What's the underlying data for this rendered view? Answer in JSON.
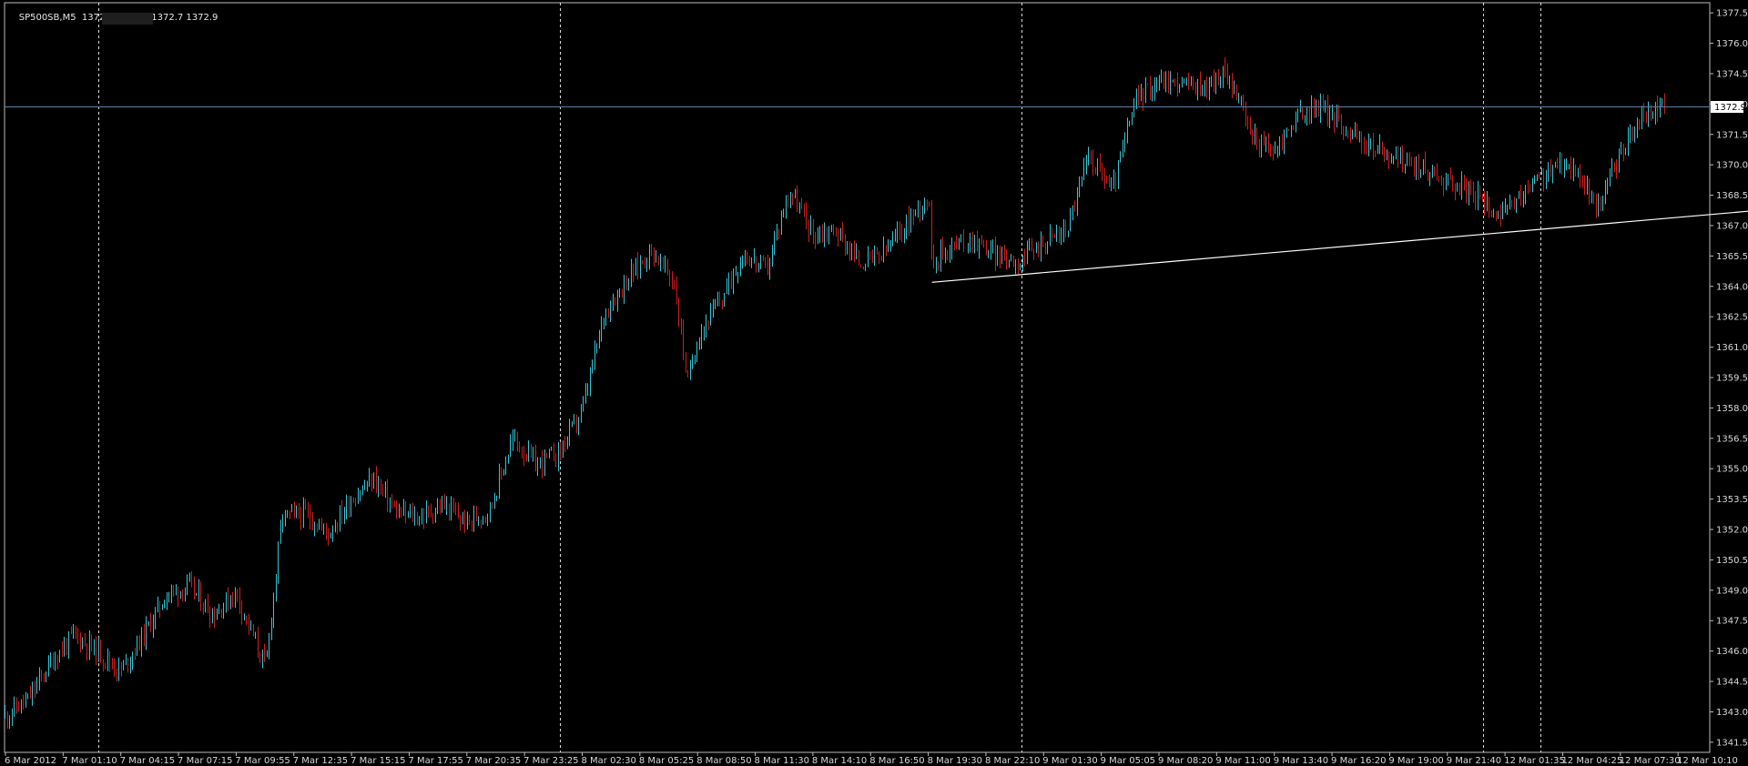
{
  "header": {
    "symbol": "SP500SB,M5",
    "ohlc": "1372.7 1372.9 1372.7 1372.9"
  },
  "colors": {
    "background": "#000000",
    "bull": "#33c6d6",
    "bear": "#d21c1c",
    "grid": "#ffffff",
    "price_line": "#5b7fa8",
    "trendline": "#ffffff",
    "axis_text": "#d8d8d8"
  },
  "chart_data": {
    "type": "line",
    "subtype": "candlestick",
    "title": "",
    "xlabel": "",
    "ylabel": "",
    "ylim": [
      1341.0,
      1378.0
    ],
    "current_price": "1372.9",
    "y_ticks": [
      "1377.5",
      "1376.0",
      "1374.5",
      "1373.0",
      "1371.5",
      "1370.0",
      "1368.5",
      "1367.0",
      "1365.5",
      "1364.0",
      "1362.5",
      "1361.0",
      "1359.5",
      "1358.0",
      "1356.5",
      "1355.0",
      "1353.5",
      "1352.0",
      "1350.5",
      "1349.0",
      "1347.5",
      "1346.0",
      "1344.5",
      "1343.0",
      "1341.5"
    ],
    "x_ticks": [
      "6 Mar 2012",
      "7 Mar 01:10",
      "7 Mar 04:15",
      "7 Mar 07:15",
      "7 Mar 09:55",
      "7 Mar 12:35",
      "7 Mar 15:15",
      "7 Mar 17:55",
      "7 Mar 20:35",
      "7 Mar 23:25",
      "8 Mar 02:30",
      "8 Mar 05:25",
      "8 Mar 08:50",
      "8 Mar 11:30",
      "8 Mar 14:10",
      "8 Mar 16:50",
      "8 Mar 19:30",
      "8 Mar 22:10",
      "9 Mar 01:30",
      "9 Mar 05:05",
      "9 Mar 08:20",
      "9 Mar 11:00",
      "9 Mar 13:40",
      "9 Mar 16:20",
      "9 Mar 19:00",
      "9 Mar 21:40",
      "12 Mar 01:35",
      "12 Mar 04:25",
      "12 Mar 07:30",
      "12 Mar 10:10"
    ],
    "period_separators_at_tick": [
      1,
      9,
      17,
      25,
      26
    ],
    "price_path": [
      [
        0,
        1342.8
      ],
      [
        1,
        1343.6
      ],
      [
        2,
        1345.5
      ],
      [
        3,
        1346.8
      ],
      [
        4,
        1346.0
      ],
      [
        5,
        1345.0
      ],
      [
        6,
        1346.8
      ],
      [
        7,
        1348.8
      ],
      [
        8,
        1349.2
      ],
      [
        9,
        1347.8
      ],
      [
        10,
        1348.9
      ],
      [
        11,
        1346.0
      ],
      [
        11.3,
        1345.2
      ],
      [
        12,
        1352.6
      ],
      [
        13,
        1352.8
      ],
      [
        14,
        1351.8
      ],
      [
        15,
        1353.5
      ],
      [
        16,
        1354.5
      ],
      [
        17,
        1352.8
      ],
      [
        18,
        1352.6
      ],
      [
        19,
        1353.2
      ],
      [
        20,
        1352.3
      ],
      [
        21,
        1353.0
      ],
      [
        22,
        1356.5
      ],
      [
        23,
        1355.2
      ],
      [
        24,
        1355.8
      ],
      [
        25,
        1357.8
      ],
      [
        26,
        1362.8
      ],
      [
        27,
        1364.4
      ],
      [
        28,
        1365.8
      ],
      [
        29,
        1364.2
      ],
      [
        29.6,
        1359.2
      ],
      [
        30,
        1361.5
      ],
      [
        31,
        1363.3
      ],
      [
        32,
        1365.6
      ],
      [
        33,
        1364.8
      ],
      [
        34,
        1368.8
      ],
      [
        35,
        1366.6
      ],
      [
        36,
        1366.8
      ],
      [
        37,
        1365.2
      ],
      [
        38,
        1365.5
      ],
      [
        39,
        1367.0
      ],
      [
        40,
        1368.5
      ],
      [
        40.2,
        1365.3
      ],
      [
        41,
        1366.0
      ],
      [
        42,
        1366.3
      ],
      [
        43,
        1365.5
      ],
      [
        44,
        1365.3
      ],
      [
        45,
        1366.2
      ],
      [
        46,
        1366.8
      ],
      [
        47,
        1370.5
      ],
      [
        48,
        1368.8
      ],
      [
        49,
        1373.2
      ],
      [
        50,
        1374.2
      ],
      [
        51,
        1374.0
      ],
      [
        52,
        1373.8
      ],
      [
        53,
        1374.6
      ],
      [
        54,
        1371.5
      ],
      [
        55,
        1370.6
      ],
      [
        56,
        1372.4
      ],
      [
        57,
        1372.9
      ],
      [
        58,
        1371.9
      ],
      [
        59,
        1371.0
      ],
      [
        60,
        1370.5
      ],
      [
        61,
        1370.0
      ],
      [
        62,
        1369.5
      ],
      [
        63,
        1369.0
      ],
      [
        64,
        1368.2
      ],
      [
        65,
        1367.5
      ],
      [
        66,
        1368.8
      ],
      [
        67,
        1369.8
      ],
      [
        68,
        1370.0
      ],
      [
        69,
        1367.8
      ],
      [
        70,
        1370.5
      ],
      [
        71,
        1372.4
      ],
      [
        72,
        1372.9
      ]
    ],
    "trendline": {
      "from": [
        40.2,
        1364.2
      ],
      "to": [
        76.5,
        1367.8
      ]
    },
    "trendline_visible": true,
    "grid": false
  }
}
